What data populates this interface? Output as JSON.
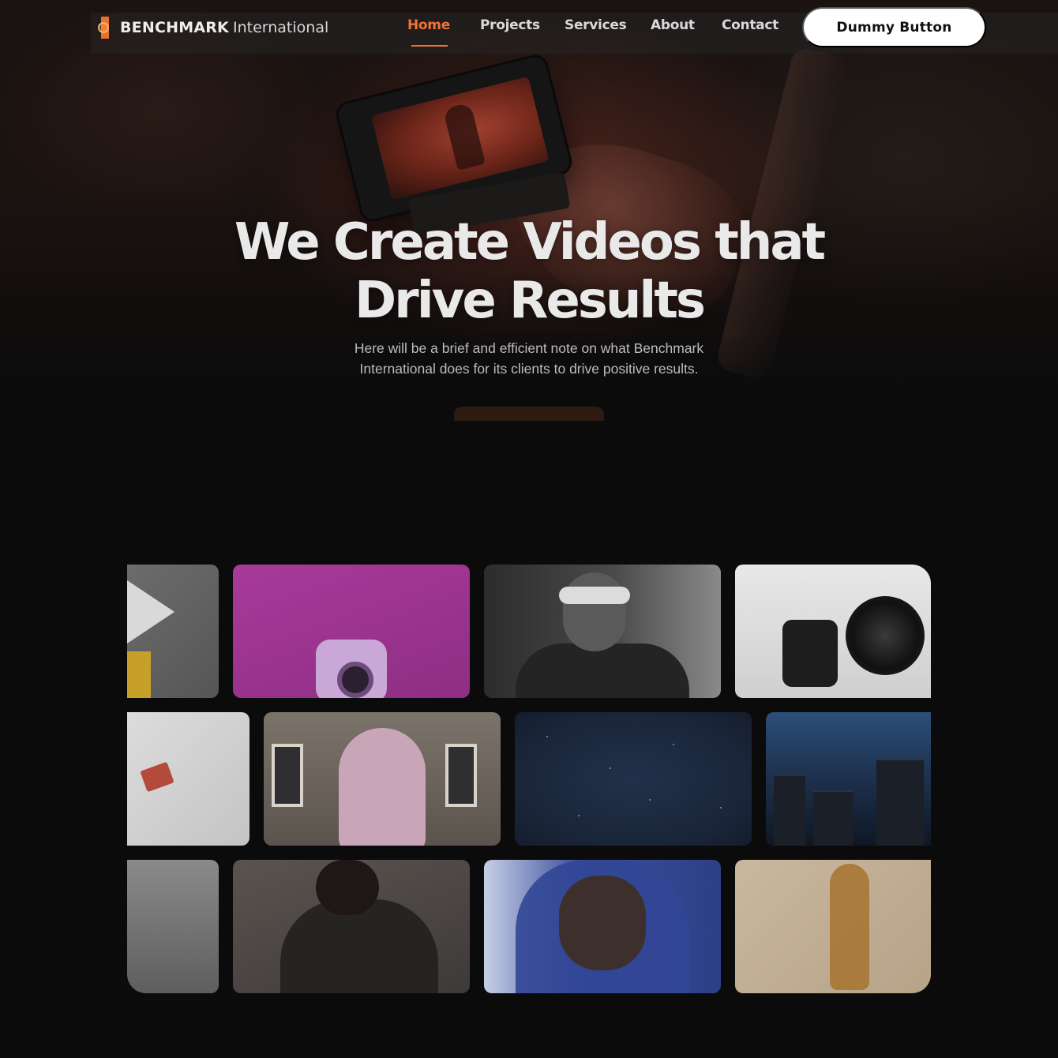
{
  "brand": {
    "name_bold": "BENCHMARK",
    "name_light": "International",
    "accent_color": "#ef7335"
  },
  "nav": {
    "items": [
      {
        "label": "Home",
        "active": true
      },
      {
        "label": "Projects",
        "active": false
      },
      {
        "label": "Services",
        "active": false
      },
      {
        "label": "About",
        "active": false
      },
      {
        "label": "Contact",
        "active": false
      }
    ],
    "cta_label": "Dummy Button"
  },
  "hero": {
    "headline_line1": "We Create Videos that",
    "headline_line2": "Drive Results",
    "subtext_line1": "Here will be a brief and efficient note on what Benchmark",
    "subtext_line2": "International does for its clients to drive positive results."
  },
  "gallery": {
    "rows": [
      [
        "yellow-sign-thumbnail",
        "pink-instant-camera-thumbnail",
        "sunglasses-portrait-thumbnail",
        "dslr-camera-thumbnail"
      ],
      [
        "red-kite-thumbnail",
        "pink-hoodie-street-thumbnail",
        "night-sky-thumbnail",
        "city-skyline-thumbnail"
      ],
      [
        "trees-thumbnail",
        "woman-portrait-thumbnail",
        "blue-hood-portrait-thumbnail",
        "golden-figure-thumbnail"
      ]
    ]
  }
}
